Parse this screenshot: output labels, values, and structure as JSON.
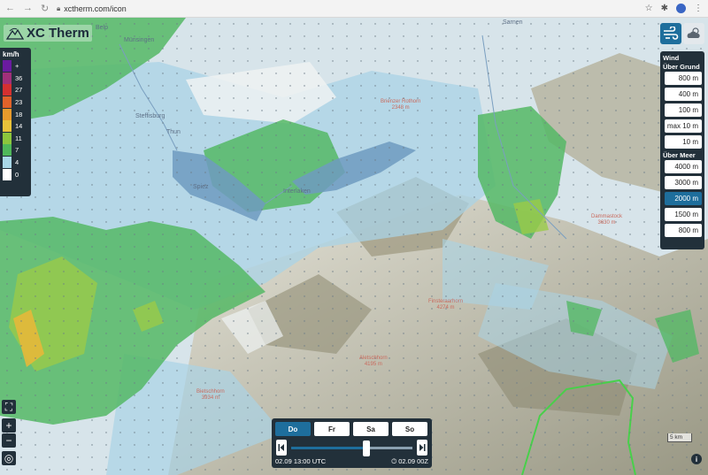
{
  "browser": {
    "url": "xctherm.com/icon"
  },
  "app": {
    "logo_text": "XC Therm"
  },
  "legend": {
    "unit": "km/h",
    "items": [
      {
        "label": "+",
        "color": "#6a1ba0"
      },
      {
        "label": "36",
        "color": "#a0307a"
      },
      {
        "label": "27",
        "color": "#d43030"
      },
      {
        "label": "23",
        "color": "#e0622a"
      },
      {
        "label": "18",
        "color": "#e79a2c"
      },
      {
        "label": "14",
        "color": "#e8c33a"
      },
      {
        "label": "11",
        "color": "#8cc63c"
      },
      {
        "label": "7",
        "color": "#4fb85a"
      },
      {
        "label": "4",
        "color": "#a9d8e8"
      },
      {
        "label": "0",
        "color": "#ffffff"
      }
    ]
  },
  "panel": {
    "wind_header": "Wind",
    "ground_header": "Über Grund",
    "ground_levels": [
      "800 m",
      "400 m",
      "100 m",
      "max 10 m",
      "10 m"
    ],
    "sea_header": "Über Meer",
    "sea_levels": [
      "4000 m",
      "3000 m",
      "2000 m",
      "1500 m",
      "800 m"
    ],
    "selected": "2000 m"
  },
  "places": [
    "Belp",
    "Münsingen",
    "Steffisburg",
    "Thun",
    "Spiez",
    "Interlaken",
    "Sarnen"
  ],
  "peaks": [
    {
      "name": "Brienzer Rothorn",
      "alt": "2348 m"
    },
    {
      "name": "Dammastock",
      "alt": "3630 m"
    },
    {
      "name": "Finsteraarhorn",
      "alt": "4274 m"
    },
    {
      "name": "Aletschhorn",
      "alt": "4195 m"
    },
    {
      "name": "Bietschhorn",
      "alt": "3934 m"
    }
  ],
  "controls": {
    "fullscreen": "⛶",
    "zoom_in": "+",
    "zoom_out": "−",
    "locate": "◎"
  },
  "timebar": {
    "days": [
      "Do",
      "Fr",
      "Sa",
      "So"
    ],
    "selected_day": "Do",
    "current_time": "02.09 13:00 UTC",
    "model_run": "02.09 00Z",
    "slider_position": 0.62
  },
  "scale": "5 km",
  "info": "i"
}
